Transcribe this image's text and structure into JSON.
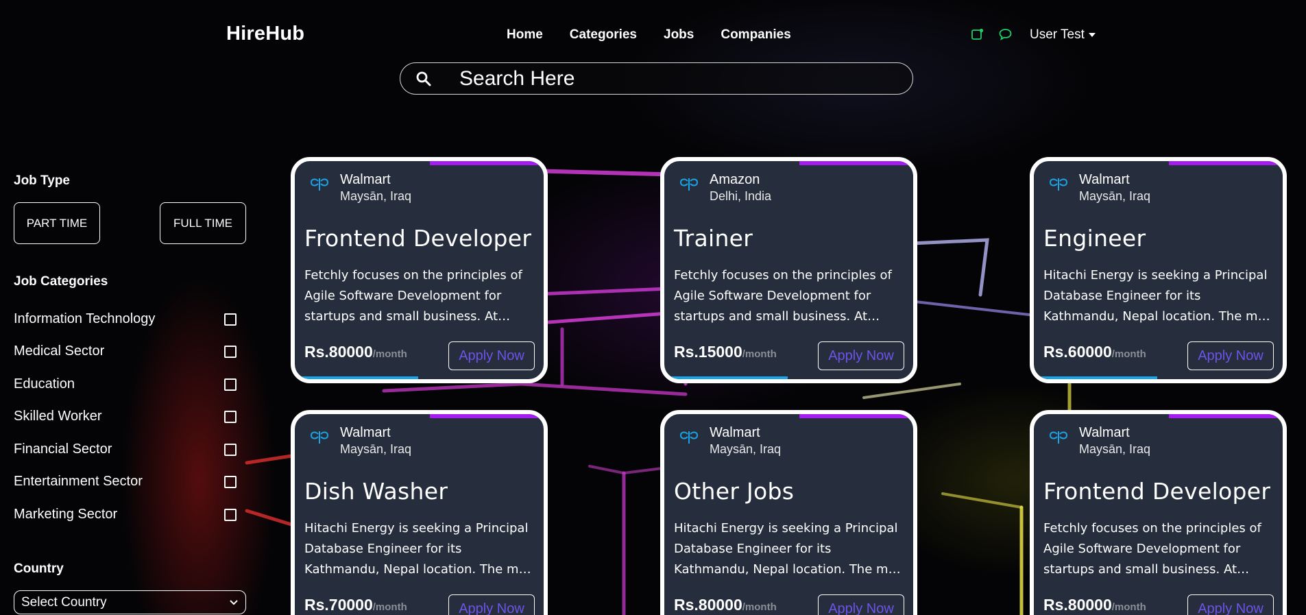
{
  "header": {
    "brand": "HireHub",
    "nav": [
      "Home",
      "Categories",
      "Jobs",
      "Companies"
    ],
    "icons": [
      "notification-icon",
      "chat-icon"
    ],
    "user": "User Test",
    "accent": "#1fcf6a"
  },
  "search": {
    "placeholder": "Search Here"
  },
  "sidebar": {
    "job_type_heading": "Job Type",
    "job_types": [
      "PART TIME",
      "FULL TIME"
    ],
    "categories_heading": "Job Categories",
    "categories": [
      "Information Technology",
      "Medical Sector",
      "Education",
      "Skilled Worker",
      "Financial Sector",
      "Entertainment Sector",
      "Marketing Sector"
    ],
    "country_heading": "Country",
    "country_select": "Select Country"
  },
  "cards": [
    {
      "company": "Walmart",
      "location": "Maysān, Iraq",
      "title": "Frontend Developer",
      "description": "Fetchly focuses on the principles of Agile Software Development for startups and small business. At Fetchly we value collaboration and growth.",
      "price": "Rs.80000",
      "period": "/month",
      "button": "Apply Now"
    },
    {
      "company": "Amazon",
      "location": "Delhi, India",
      "title": "Trainer",
      "description": "Fetchly focuses on the principles of Agile Software Development for startups and small business. At Fetchly we value collaboration and growth.",
      "price": "Rs.15000",
      "period": "/month",
      "button": "Apply Now"
    },
    {
      "company": "Walmart",
      "location": "Maysān, Iraq",
      "title": "Engineer",
      "description": "Hitachi Energy is seeking a Principal Database Engineer for its Kathmandu, Nepal location. The main purpose of this role is to lead.",
      "price": "Rs.60000",
      "period": "/month",
      "button": "Apply Now"
    },
    {
      "company": "Walmart",
      "location": "Maysān, Iraq",
      "title": "Dish Washer",
      "description": "Hitachi Energy is seeking a Principal Database Engineer for its Kathmandu, Nepal location. The main purpose of this role is to lead.",
      "price": "Rs.70000",
      "period": "/month",
      "button": "Apply Now"
    },
    {
      "company": "Walmart",
      "location": "Maysān, Iraq",
      "title": "Other Jobs",
      "description": "Hitachi Energy is seeking a Principal Database Engineer for its Kathmandu, Nepal location. The main purpose of this role is to lead.",
      "price": "Rs.80000",
      "period": "/month",
      "button": "Apply Now"
    },
    {
      "company": "Walmart",
      "location": "Maysān, Iraq",
      "title": "Frontend Developer",
      "description": "Fetchly focuses on the principles of Agile Software Development for startups and small business. At Fetchly we value collaboration and growth.",
      "price": "Rs.80000",
      "period": "/month",
      "button": "Apply Now"
    }
  ]
}
